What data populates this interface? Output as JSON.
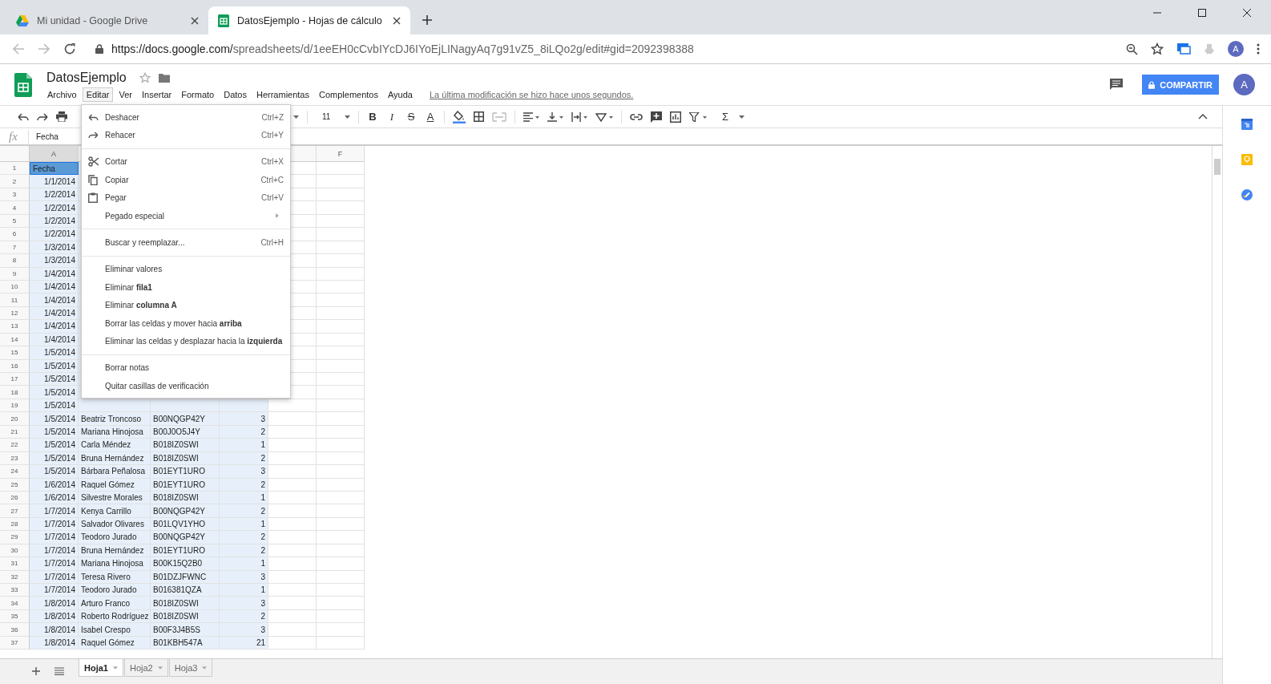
{
  "browser": {
    "tabs": [
      {
        "title": "Mi unidad - Google Drive",
        "selected": false
      },
      {
        "title": "DatosEjemplo - Hojas de cálculo",
        "selected": true
      }
    ],
    "url_host": "https://docs.google.com/",
    "url_path": "spreadsheets/d/1eeEH0cCvbIYcDJ6IYoEjLINagyAq7g91vZ5_8iLQo2g/edit#gid=2092398388",
    "avatar": "A"
  },
  "doc": {
    "title": "DatosEjemplo",
    "menus": [
      {
        "label": "Archivo",
        "selected": false
      },
      {
        "label": "Editar",
        "selected": true
      },
      {
        "label": "Ver",
        "selected": false
      },
      {
        "label": "Insertar",
        "selected": false
      },
      {
        "label": "Formato",
        "selected": false
      },
      {
        "label": "Datos",
        "selected": false
      },
      {
        "label": "Herramientas",
        "selected": false
      },
      {
        "label": "Complementos",
        "selected": false
      },
      {
        "label": "Ayuda",
        "selected": false
      }
    ],
    "last_edit": "La última modificación se hizo hace unos segundos.",
    "share_button": "COMPARTIR",
    "avatar": "A"
  },
  "toolbar": {
    "font_size": "11",
    "text_format": [
      "B",
      "I",
      "S",
      "A"
    ],
    "sum": "Σ"
  },
  "formula_bar": {
    "label": "fx",
    "value": "Fecha"
  },
  "edit_menu": [
    {
      "kind": "item",
      "label": "Deshacer",
      "shortcut": "Ctrl+Z"
    },
    {
      "kind": "item",
      "label": "Rehacer",
      "shortcut": "Ctrl+Y"
    },
    {
      "kind": "separator"
    },
    {
      "kind": "item",
      "label": "Cortar",
      "shortcut": "Ctrl+X"
    },
    {
      "kind": "item",
      "label": "Copiar",
      "shortcut": "Ctrl+C"
    },
    {
      "kind": "item",
      "label": "Pegar",
      "shortcut": "Ctrl+V"
    },
    {
      "kind": "submenu",
      "label": "Pegado especial"
    },
    {
      "kind": "separator"
    },
    {
      "kind": "item",
      "label": "Buscar y reemplazar...",
      "shortcut": "Ctrl+H"
    },
    {
      "kind": "separator"
    },
    {
      "kind": "item",
      "label": "Eliminar valores"
    },
    {
      "kind": "item",
      "label": "Eliminar **fila1**"
    },
    {
      "kind": "item",
      "label": "Eliminar **columna A**"
    },
    {
      "kind": "item",
      "label": "Borrar las celdas y mover hacia **arriba**"
    },
    {
      "kind": "item",
      "label": "Eliminar las celdas y desplazar hacia la **izquierda**"
    },
    {
      "kind": "separator"
    },
    {
      "kind": "item",
      "label": "Borrar notas"
    },
    {
      "kind": "item",
      "label": "Quitar casillas de verificación"
    }
  ],
  "sheet": {
    "columns": [
      {
        "label": "A",
        "selected": true
      },
      {
        "label": "F",
        "selected": false
      }
    ],
    "rows": [
      {
        "number": "1",
        "selected": true,
        "active": true,
        "cells": [
          "Fecha"
        ]
      },
      {
        "number": "2",
        "selected": true,
        "active": false,
        "cells": [
          "1/1/2014"
        ]
      },
      {
        "number": "3",
        "selected": true,
        "active": false,
        "cells": [
          "1/2/2014"
        ]
      },
      {
        "number": "4",
        "selected": true,
        "active": false,
        "cells": [
          "1/2/2014"
        ]
      },
      {
        "number": "5",
        "selected": true,
        "active": false,
        "cells": [
          "1/2/2014"
        ]
      },
      {
        "number": "6",
        "selected": true,
        "active": false,
        "cells": [
          "1/2/2014"
        ]
      },
      {
        "number": "7",
        "selected": true,
        "active": false,
        "cells": [
          "1/3/2014"
        ]
      },
      {
        "number": "8",
        "selected": true,
        "active": false,
        "cells": [
          "1/3/2014"
        ]
      },
      {
        "number": "9",
        "selected": true,
        "active": false,
        "cells": [
          "1/4/2014"
        ]
      },
      {
        "number": "10",
        "selected": true,
        "active": false,
        "cells": [
          "1/4/2014"
        ]
      },
      {
        "number": "11",
        "selected": true,
        "active": false,
        "cells": [
          "1/4/2014"
        ]
      },
      {
        "number": "12",
        "selected": true,
        "active": false,
        "cells": [
          "1/4/2014"
        ]
      },
      {
        "number": "13",
        "selected": true,
        "active": false,
        "cells": [
          "1/4/2014"
        ]
      },
      {
        "number": "14",
        "selected": true,
        "active": false,
        "cells": [
          "1/4/2014"
        ]
      },
      {
        "number": "15",
        "selected": true,
        "active": false,
        "cells": [
          "1/5/2014"
        ]
      },
      {
        "number": "16",
        "selected": true,
        "active": false,
        "cells": [
          "1/5/2014"
        ]
      },
      {
        "number": "17",
        "selected": true,
        "active": false,
        "cells": [
          "1/5/2014"
        ]
      },
      {
        "number": "18",
        "selected": true,
        "active": false,
        "cells": [
          "1/5/2014"
        ]
      },
      {
        "number": "19",
        "selected": true,
        "active": false,
        "cells": [
          "1/5/2014"
        ]
      },
      {
        "number": "20",
        "selected": true,
        "active": false,
        "cells": [
          "1/5/2014",
          "Beatriz Troncoso",
          "B00NQGP42Y",
          "3"
        ]
      },
      {
        "number": "21",
        "selected": true,
        "active": false,
        "cells": [
          "1/5/2014",
          "Mariana Hinojosa",
          "B00J0O5J4Y",
          "2"
        ]
      },
      {
        "number": "22",
        "selected": true,
        "active": false,
        "cells": [
          "1/5/2014",
          "Carla Méndez",
          "B018IZ0SWI",
          "1"
        ]
      },
      {
        "number": "23",
        "selected": true,
        "active": false,
        "cells": [
          "1/5/2014",
          "Bruna Hernández",
          "B018IZ0SWI",
          "2"
        ]
      },
      {
        "number": "24",
        "selected": true,
        "active": false,
        "cells": [
          "1/5/2014",
          "Bárbara Peñalosa",
          "B01EYT1URO",
          "3"
        ]
      },
      {
        "number": "25",
        "selected": true,
        "active": false,
        "cells": [
          "1/6/2014",
          "Raquel Gómez",
          "B01EYT1URO",
          "2"
        ]
      },
      {
        "number": "26",
        "selected": true,
        "active": false,
        "cells": [
          "1/6/2014",
          "Silvestre Morales",
          "B018IZ0SWI",
          "1"
        ]
      },
      {
        "number": "27",
        "selected": true,
        "active": false,
        "cells": [
          "1/7/2014",
          "Kenya Carrillo",
          "B00NQGP42Y",
          "2"
        ]
      },
      {
        "number": "28",
        "selected": true,
        "active": false,
        "cells": [
          "1/7/2014",
          "Salvador Olivares",
          "B01LQV1YHO",
          "1"
        ]
      },
      {
        "number": "29",
        "selected": true,
        "active": false,
        "cells": [
          "1/7/2014",
          "Teodoro Jurado",
          "B00NQGP42Y",
          "2"
        ]
      },
      {
        "number": "30",
        "selected": true,
        "active": false,
        "cells": [
          "1/7/2014",
          "Bruna Hernández",
          "B01EYT1URO",
          "2"
        ]
      },
      {
        "number": "31",
        "selected": true,
        "active": false,
        "cells": [
          "1/7/2014",
          "Mariana Hinojosa",
          "B00K15Q2B0",
          "1"
        ]
      },
      {
        "number": "32",
        "selected": true,
        "active": false,
        "cells": [
          "1/7/2014",
          "Teresa Rivero",
          "B01DZJFWNC",
          "3"
        ]
      },
      {
        "number": "33",
        "selected": true,
        "active": false,
        "cells": [
          "1/7/2014",
          "Teodoro Jurado",
          "B016381QZA",
          "1"
        ]
      },
      {
        "number": "34",
        "selected": true,
        "active": false,
        "cells": [
          "1/8/2014",
          "Arturo Franco",
          "B018IZ0SWI",
          "3"
        ]
      },
      {
        "number": "35",
        "selected": true,
        "active": false,
        "cells": [
          "1/8/2014",
          "Roberto Rodríguez",
          "B018IZ0SWI",
          "2"
        ]
      },
      {
        "number": "36",
        "selected": true,
        "active": false,
        "cells": [
          "1/8/2014",
          "Isabel Crespo",
          "B00F3J4B5S",
          "3"
        ]
      },
      {
        "number": "37",
        "selected": true,
        "active": false,
        "cells": [
          "1/8/2014",
          "Raquel Gómez",
          "B01KBH547A",
          "21"
        ]
      }
    ]
  },
  "sheet_tabs": [
    {
      "label": "Hoja1",
      "selected": true
    },
    {
      "label": "Hoja2",
      "selected": false
    },
    {
      "label": "Hoja3",
      "selected": false
    }
  ]
}
